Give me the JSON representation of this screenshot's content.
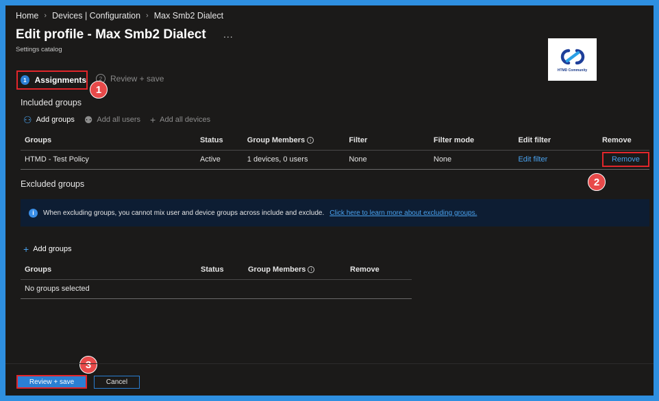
{
  "breadcrumb": [
    "Home",
    "Devices | Configuration",
    "Max Smb2 Dialect"
  ],
  "header": {
    "title": "Edit profile - Max Smb2 Dialect",
    "more": "...",
    "subtitle": "Settings catalog"
  },
  "logo": {
    "text": "HTMD Community"
  },
  "steps": [
    {
      "number": "1",
      "label": "Assignments",
      "active": true
    },
    {
      "number": "2",
      "label": "Review + save",
      "active": false
    }
  ],
  "callouts": [
    "1",
    "2",
    "3"
  ],
  "included": {
    "label": "Included groups",
    "toolbar": {
      "add_groups": "Add groups",
      "add_all_users": "Add all users",
      "add_all_devices": "Add all devices"
    },
    "columns": [
      "Groups",
      "Status",
      "Group Members",
      "Filter",
      "Filter mode",
      "Edit filter",
      "Remove"
    ],
    "rows": [
      {
        "group": "HTMD - Test Policy",
        "status": "Active",
        "members": "1 devices, 0 users",
        "filter": "None",
        "filter_mode": "None",
        "edit_filter": "Edit filter",
        "remove": "Remove"
      }
    ]
  },
  "excluded": {
    "label": "Excluded groups",
    "info_text": "When excluding groups, you cannot mix user and device groups across include and exclude.",
    "info_link": "Click here to learn more about excluding groups.",
    "add_groups": "Add groups",
    "columns": [
      "Groups",
      "Status",
      "Group Members",
      "Remove"
    ],
    "empty_text": "No groups selected"
  },
  "footer": {
    "review_save": "Review + save",
    "cancel": "Cancel"
  },
  "colors": {
    "accent": "#2a7fd4",
    "highlight": "#e3262b",
    "link": "#4aa3f0",
    "background": "#1b1a19"
  }
}
